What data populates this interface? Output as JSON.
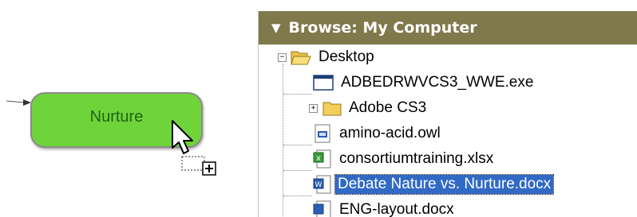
{
  "canvas": {
    "node_label": "Nurture"
  },
  "browse_panel": {
    "title": "Browse: My Computer",
    "tree": {
      "root": "Desktop",
      "items": [
        {
          "label": "ADBEDRWVCS3_WWE.exe",
          "icon": "application-icon"
        },
        {
          "label": "Adobe CS3",
          "icon": "folder-icon"
        },
        {
          "label": "amino-acid.owl",
          "icon": "owl-file-icon"
        },
        {
          "label": "consortiumtraining.xlsx",
          "icon": "excel-file-icon"
        },
        {
          "label": "Debate Nature vs. Nurture.docx",
          "icon": "word-file-icon",
          "selected": true
        },
        {
          "label": "ENG-layout.docx",
          "icon": "word-file-icon"
        }
      ]
    },
    "colors": {
      "header_bg": "#80794b",
      "selection_bg": "#316ac5",
      "node_fill": "#6fd43a"
    }
  }
}
